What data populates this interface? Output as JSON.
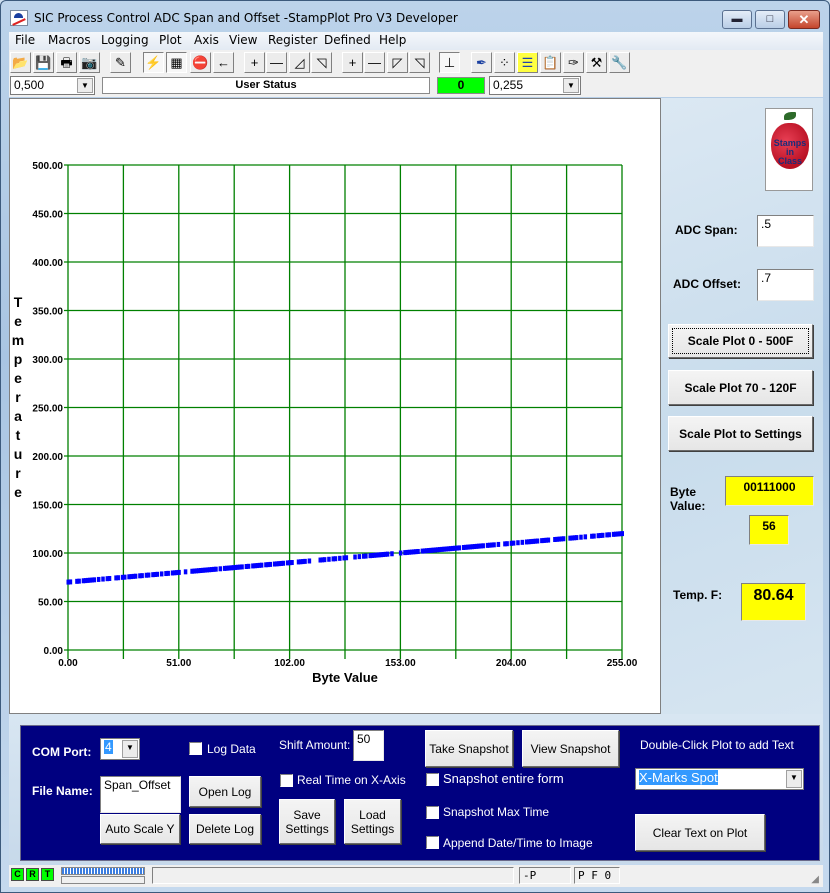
{
  "window": {
    "title": "SIC Process Control ADC Span and Offset -StampPlot Pro V3 Developer",
    "controls": {
      "minimize": "▬",
      "maximize": "□",
      "close": "✕"
    }
  },
  "menu": [
    "File",
    "Macros",
    "Logging",
    "Plot",
    "Axis",
    "View",
    "Register",
    "Defined",
    "Help"
  ],
  "toolbar": {
    "buttons": [
      {
        "name": "open-folder-icon",
        "glyph": "📂"
      },
      {
        "name": "save-disk-icon",
        "glyph": "💾"
      },
      {
        "name": "print-icon",
        "glyph": "🖶"
      },
      {
        "name": "camera-icon",
        "glyph": "📷"
      },
      {
        "name": "clear-wand-icon",
        "glyph": "✎"
      },
      {
        "name": "connect-plug-icon",
        "glyph": "⚡"
      },
      {
        "name": "plot-grid-icon",
        "glyph": "▦"
      },
      {
        "name": "stop-sign-icon",
        "glyph": "⛔"
      },
      {
        "name": "back-arrow-icon",
        "glyph": "←"
      },
      {
        "name": "y-zoom-in-icon",
        "glyph": "+"
      },
      {
        "name": "y-zoom-out-icon",
        "glyph": "—"
      },
      {
        "name": "y-shift-up-icon",
        "glyph": "◿"
      },
      {
        "name": "y-shift-down-icon",
        "glyph": "◹"
      },
      {
        "name": "x-zoom-in-icon",
        "glyph": "+"
      },
      {
        "name": "x-zoom-out-icon",
        "glyph": "—"
      },
      {
        "name": "x-shift-right-icon",
        "glyph": "◸"
      },
      {
        "name": "x-shift-left-icon",
        "glyph": "◹"
      },
      {
        "name": "axis-icon",
        "glyph": "⊥"
      },
      {
        "name": "pen-icon",
        "glyph": "✒"
      },
      {
        "name": "data-points-icon",
        "glyph": "⁘"
      },
      {
        "name": "note-icon",
        "glyph": "☰"
      },
      {
        "name": "clipboard-icon",
        "glyph": "📋"
      },
      {
        "name": "probe-icon",
        "glyph": "✑"
      },
      {
        "name": "hammer-icon",
        "glyph": "⚒"
      },
      {
        "name": "wrench-icon",
        "glyph": "🔧"
      }
    ]
  },
  "combo_row": {
    "y_range": "0,500",
    "user_status": "User Status",
    "counter": "0",
    "x_range": "0,255"
  },
  "chart_data": {
    "type": "scatter",
    "title": "",
    "xlabel": "Byte Value",
    "ylabel": "Temperature",
    "xlim": [
      0,
      255
    ],
    "ylim": [
      0,
      500
    ],
    "x_ticks": [
      "0.00",
      "51.00",
      "102.00",
      "153.00",
      "204.00",
      "255.00"
    ],
    "y_ticks": [
      "0.00",
      "50.00",
      "100.00",
      "150.00",
      "200.00",
      "250.00",
      "300.00",
      "350.00",
      "400.00",
      "450.00",
      "500.00"
    ],
    "x_gridlines": [
      0,
      25.5,
      51,
      76.5,
      102,
      127.5,
      153,
      178.5,
      204,
      229.5,
      255
    ],
    "grid": true,
    "grid_color": "#008000",
    "point_color": "#0000ff",
    "series": [
      {
        "name": "Temperature",
        "x_start": 0,
        "x_end": 255,
        "y_start": 70,
        "y_end": 120
      }
    ]
  },
  "side": {
    "logo_text": [
      "Stamps",
      "in",
      "Class"
    ],
    "adc_span_label": "ADC Span:",
    "adc_span_value": ".5",
    "adc_offset_label": "ADC Offset:",
    "adc_offset_value": ".7",
    "scale_buttons": [
      "Scale Plot 0 - 500F",
      "Scale Plot 70 - 120F",
      "Scale Plot to Settings"
    ],
    "byte_label_1": "Byte",
    "byte_label_2": "Value:",
    "byte_binary": "00111000",
    "byte_decimal": "56",
    "temp_label": "Temp. F:",
    "temp_value": "80.64"
  },
  "controls": {
    "com_port_label": "COM Port:",
    "com_port_value": "4",
    "log_data_label": "Log Data",
    "shift_amount_label": "Shift Amount:",
    "shift_amount_value": "50",
    "real_time_label": "Real Time on X-Axis",
    "file_name_label": "File Name:",
    "file_name_value": "Span_Offset",
    "open_log": "Open Log",
    "delete_log": "Delete Log",
    "auto_scale_y": "Auto Scale Y",
    "save_settings": "Save Settings",
    "load_settings": "Load Settings",
    "take_snapshot": "Take Snapshot",
    "view_snapshot": "View Snapshot",
    "snapshot_entire_form": "Snapshot entire form",
    "snapshot_max_time": "Snapshot Max Time",
    "append_date_time": "Append Date/Time to Image",
    "double_click_hint": "Double-Click Plot to add Text",
    "text_select_value": "X-Marks Spot",
    "clear_text": "Clear Text on Plot"
  },
  "statusbar": {
    "leds": [
      "C",
      "R",
      "T"
    ],
    "panel_p": "-P",
    "panel_pf": "P F 0"
  }
}
